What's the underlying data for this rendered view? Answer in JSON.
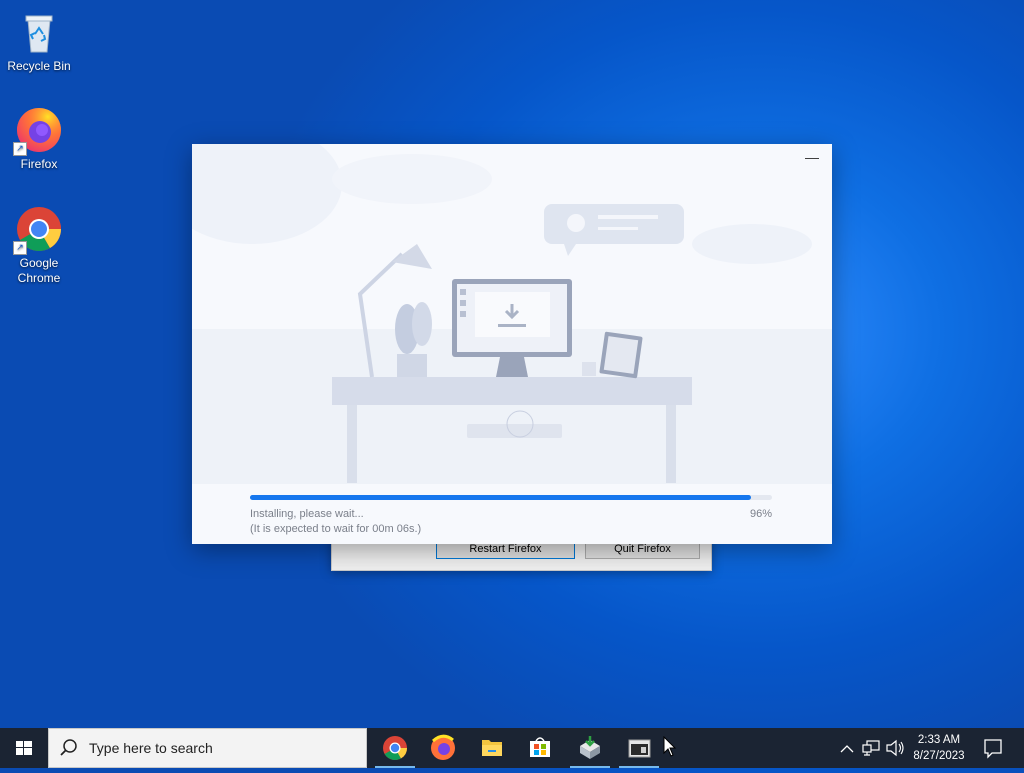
{
  "desktop": {
    "icons": [
      {
        "label": "Recycle Bin",
        "icon": "recycle-bin-icon"
      },
      {
        "label": "Firefox",
        "icon": "firefox-icon"
      },
      {
        "label": "Google Chrome",
        "icon": "chrome-icon"
      }
    ]
  },
  "background_dialog": {
    "restart_label": "Restart Firefox",
    "quit_label": "Quit Firefox"
  },
  "installer": {
    "minimize_symbol": "—",
    "status_text": "Installing, please wait...",
    "eta_text": "(It is expected to wait for 00m 06s.)",
    "progress_label": "96%",
    "progress_value": 0.96,
    "accent_color": "#1677ee"
  },
  "taskbar": {
    "search_placeholder": "Type here to search",
    "apps": [
      {
        "name": "Google Chrome",
        "icon": "chrome-icon"
      },
      {
        "name": "Firefox",
        "icon": "firefox-icon"
      },
      {
        "name": "File Explorer",
        "icon": "folder-icon"
      },
      {
        "name": "Microsoft Store",
        "icon": "store-icon"
      },
      {
        "name": "Installer",
        "icon": "installer-icon"
      },
      {
        "name": "Window",
        "icon": "window-icon"
      }
    ],
    "time": "2:33 AM",
    "date": "8/27/2023"
  }
}
